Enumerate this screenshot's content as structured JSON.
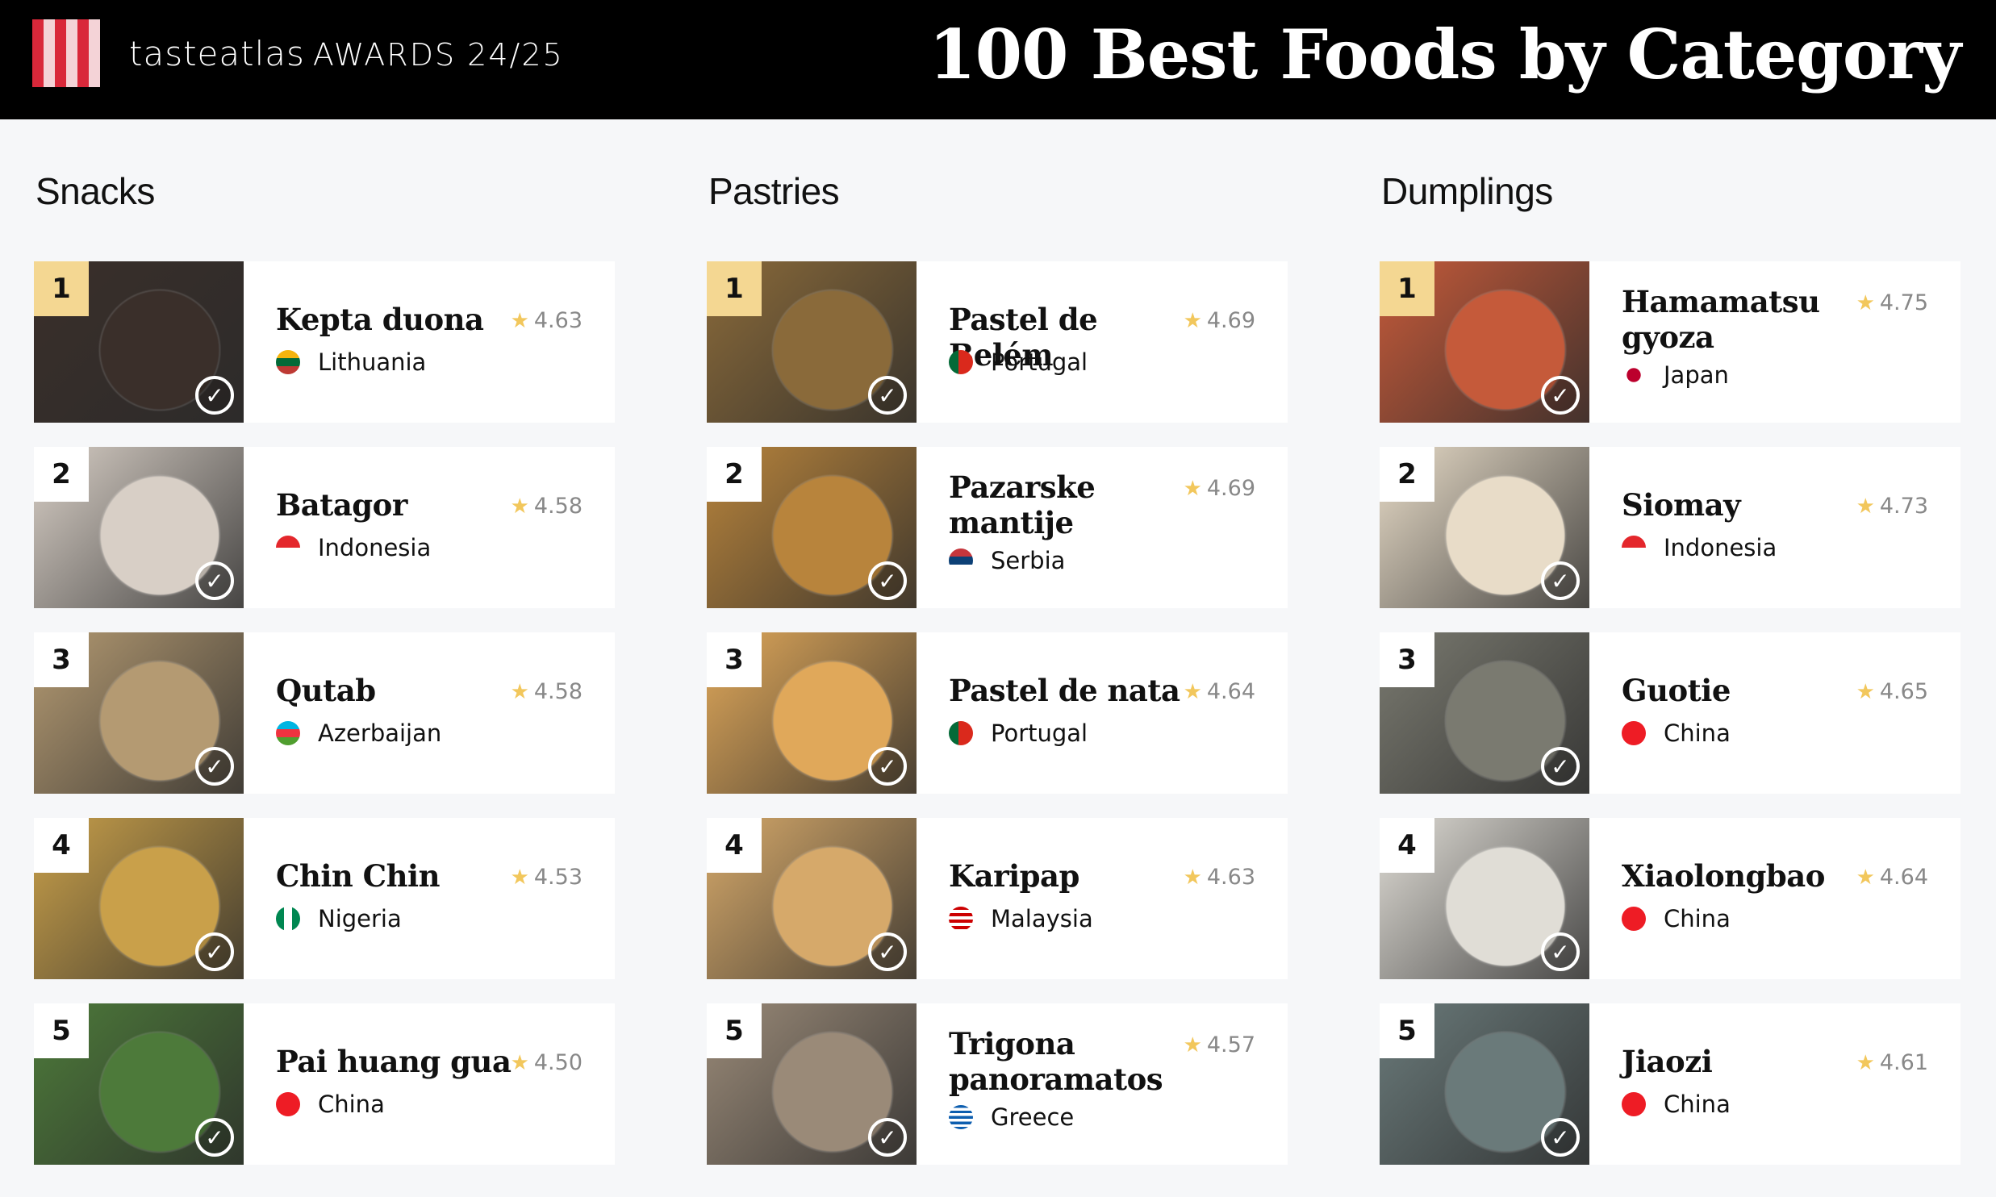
{
  "header": {
    "brand_name": "tasteatlas",
    "brand_suffix": "AWARDS 24/25",
    "headline": "100 Best Foods by Category"
  },
  "colors": {
    "header_bg": "#000000",
    "rank_gold": "#f4d792",
    "star": "#f2c75c",
    "page_bg": "#f6f7f9"
  },
  "columns": [
    {
      "title": "Snacks",
      "items": [
        {
          "rank": "1",
          "name": "Kepta duona",
          "rating": "4.63",
          "country": "Lithuania",
          "flag": "lithuania-flag-icon",
          "image": "kepta-duona-photo"
        },
        {
          "rank": "2",
          "name": "Batagor",
          "rating": "4.58",
          "country": "Indonesia",
          "flag": "indonesia-flag-icon",
          "image": "batagor-photo"
        },
        {
          "rank": "3",
          "name": "Qutab",
          "rating": "4.58",
          "country": "Azerbaijan",
          "flag": "azerbaijan-flag-icon",
          "image": "qutab-photo"
        },
        {
          "rank": "4",
          "name": "Chin Chin",
          "rating": "4.53",
          "country": "Nigeria",
          "flag": "nigeria-flag-icon",
          "image": "chin-chin-photo"
        },
        {
          "rank": "5",
          "name": "Pai huang gua",
          "rating": "4.50",
          "country": "China",
          "flag": "china-flag-icon",
          "image": "pai-huang-gua-photo"
        }
      ]
    },
    {
      "title": "Pastries",
      "items": [
        {
          "rank": "1",
          "name": "Pastel de Belém",
          "rating": "4.69",
          "country": "Portugal",
          "flag": "portugal-flag-icon",
          "image": "pastel-de-belem-photo"
        },
        {
          "rank": "2",
          "name": "Pazarske mantije",
          "rating": "4.69",
          "country": "Serbia",
          "flag": "serbia-flag-icon",
          "image": "pazarske-mantije-photo"
        },
        {
          "rank": "3",
          "name": "Pastel de nata",
          "rating": "4.64",
          "country": "Portugal",
          "flag": "portugal-flag-icon",
          "image": "pastel-de-nata-photo"
        },
        {
          "rank": "4",
          "name": "Karipap",
          "rating": "4.63",
          "country": "Malaysia",
          "flag": "malaysia-flag-icon",
          "image": "karipap-photo"
        },
        {
          "rank": "5",
          "name": "Trigona panoramatos",
          "rating": "4.57",
          "country": "Greece",
          "flag": "greece-flag-icon",
          "image": "trigona-panoramatos-photo"
        }
      ]
    },
    {
      "title": "Dumplings",
      "items": [
        {
          "rank": "1",
          "name": "Hamamatsu gyoza",
          "rating": "4.75",
          "country": "Japan",
          "flag": "japan-flag-icon",
          "image": "hamamatsu-gyoza-photo"
        },
        {
          "rank": "2",
          "name": "Siomay",
          "rating": "4.73",
          "country": "Indonesia",
          "flag": "indonesia-flag-icon",
          "image": "siomay-photo"
        },
        {
          "rank": "3",
          "name": "Guotie",
          "rating": "4.65",
          "country": "China",
          "flag": "china-flag-icon",
          "image": "guotie-photo"
        },
        {
          "rank": "4",
          "name": "Xiaolongbao",
          "rating": "4.64",
          "country": "China",
          "flag": "china-flag-icon",
          "image": "xiaolongbao-photo"
        },
        {
          "rank": "5",
          "name": "Jiaozi",
          "rating": "4.61",
          "country": "China",
          "flag": "china-flag-icon",
          "image": "jiaozi-photo"
        }
      ]
    }
  ]
}
